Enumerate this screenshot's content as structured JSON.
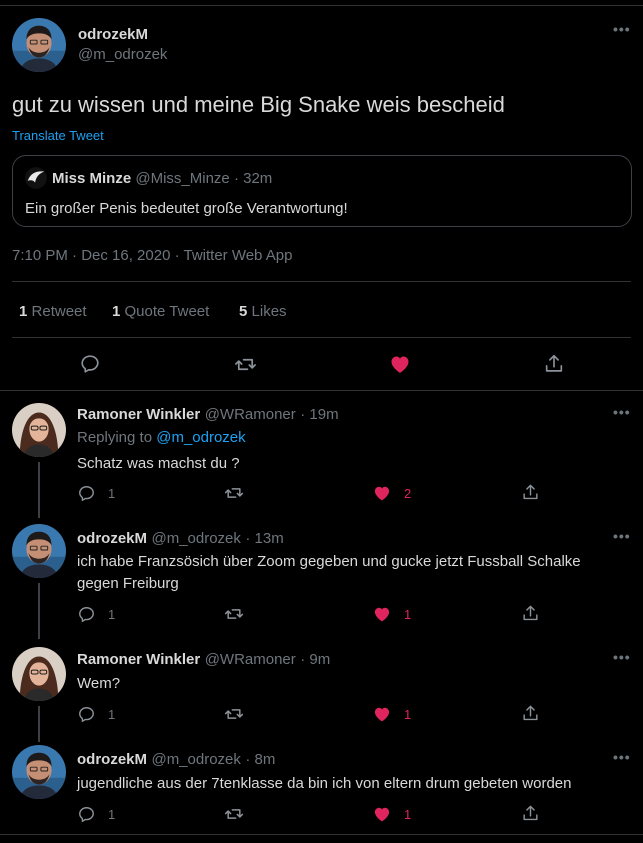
{
  "main_tweet": {
    "author_name": "odrozekM",
    "author_handle": "@m_odrozek",
    "text": "gut zu wissen und meine Big Snake weis bescheid",
    "translate": "Translate Tweet",
    "quoted": {
      "author_name": "Miss Minze",
      "author_handle": "@Miss_Minze",
      "time": "· 32m",
      "text": "Ein großer Penis bedeutet große Verantwortung!"
    },
    "meta": "7:10 PM · Dec 16, 2020 · Twitter Web App",
    "stats": {
      "retweets_count": "1",
      "retweets_label": "Retweet",
      "quotes_count": "1",
      "quotes_label": "Quote Tweet",
      "likes_count": "5",
      "likes_label": "Likes"
    }
  },
  "replies": [
    {
      "author_name": "Ramoner Winkler",
      "author_handle": "@WRamoner",
      "time": "· 19m",
      "replying_prefix": "Replying to",
      "replying_to": "@m_odrozek",
      "text": "Schatz was machst du ?",
      "reply_count": "1",
      "like_count": "2"
    },
    {
      "author_name": "odrozekM",
      "author_handle": "@m_odrozek",
      "time": "· 13m",
      "text_line1": "ich habe Franzsösich über Zoom gegeben und gucke jetzt Fussball Schalke",
      "text_line2": "gegen Freiburg",
      "reply_count": "1",
      "like_count": "1"
    },
    {
      "author_name": "Ramoner Winkler",
      "author_handle": "@WRamoner",
      "time": "· 9m",
      "text": "Wem?",
      "reply_count": "1",
      "like_count": "1"
    },
    {
      "author_name": "odrozekM",
      "author_handle": "@m_odrozek",
      "time": "· 8m",
      "text": "jugendliche aus der 7tenklasse da bin ich von eltern drum gebeten worden",
      "reply_count": "1",
      "like_count": "1"
    }
  ],
  "colors": {
    "background": "#000000",
    "accent": "#1da1f2",
    "like": "#e0245e",
    "muted": "#6e767d",
    "border": "#2f3336"
  },
  "icons": [
    "more-icon",
    "reply-icon",
    "retweet-icon",
    "heart-icon",
    "share-icon"
  ]
}
